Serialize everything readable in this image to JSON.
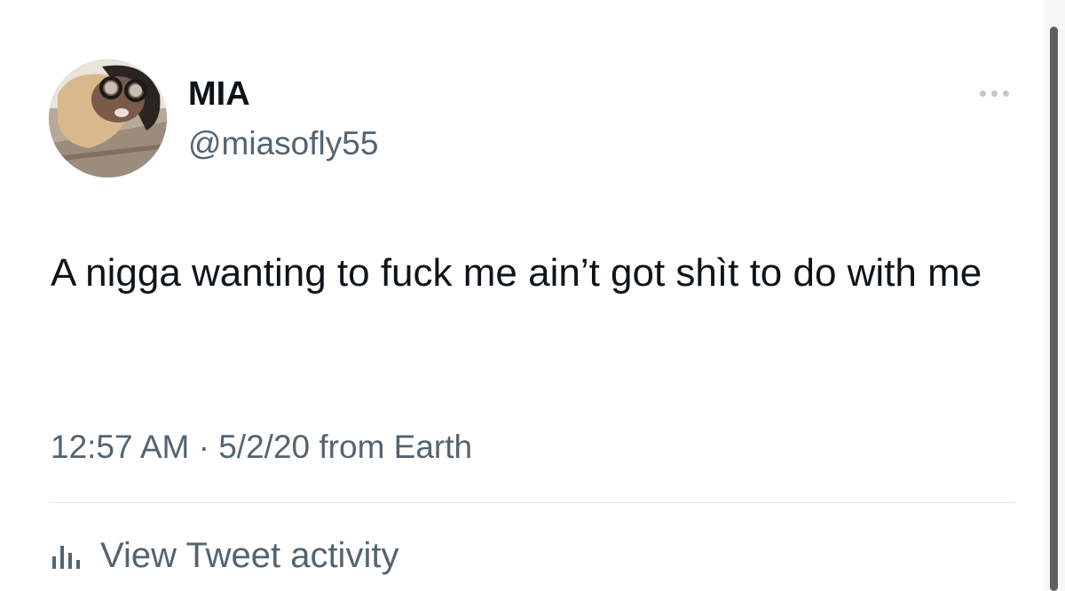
{
  "tweet": {
    "author": {
      "display_name": "MIA",
      "handle": "@miasofly55"
    },
    "text": "A nigga wanting to fuck me ain’t got shìt to do with me",
    "meta": {
      "time": "12:57 AM",
      "separator": "·",
      "date": "5/2/20",
      "source": "from Earth"
    },
    "activity_label": "View Tweet activity"
  },
  "icons": {
    "more": "more-horizontal-icon",
    "activity": "bar-chart-icon"
  },
  "colors": {
    "text_primary": "#0f1419",
    "text_secondary": "#536471",
    "divider": "#dfe3e7",
    "scrollbar": "#5f5f5f"
  }
}
